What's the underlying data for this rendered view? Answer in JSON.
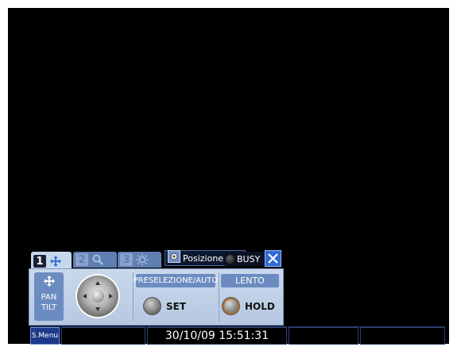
{
  "ptz": {
    "tabs": [
      {
        "number": "1",
        "icon": "move-arrows-icon",
        "active": true
      },
      {
        "number": "2",
        "icon": "zoom-magnifier-icon",
        "active": false
      },
      {
        "number": "3",
        "icon": "brightness-sun-icon",
        "active": false
      }
    ],
    "posizione_label": "Posizione",
    "busy_label": "BUSY",
    "pan_tilt_label": "PAN\nTILT",
    "preset_auto_label": "PRESELEZIONE/AUTO",
    "lento_label": "LENTO",
    "set_label": "SET",
    "hold_label": "HOLD"
  },
  "status_bar": {
    "menu_label": "S.Menu",
    "datetime": "30/10/09 15:51:31"
  },
  "colors": {
    "panel_bg": "#c9d8ec",
    "button_blue": "#6c8cc1",
    "close_blue": "#2f6ad6",
    "status_border": "#2a3f6e",
    "screen_bg": "#000000"
  }
}
